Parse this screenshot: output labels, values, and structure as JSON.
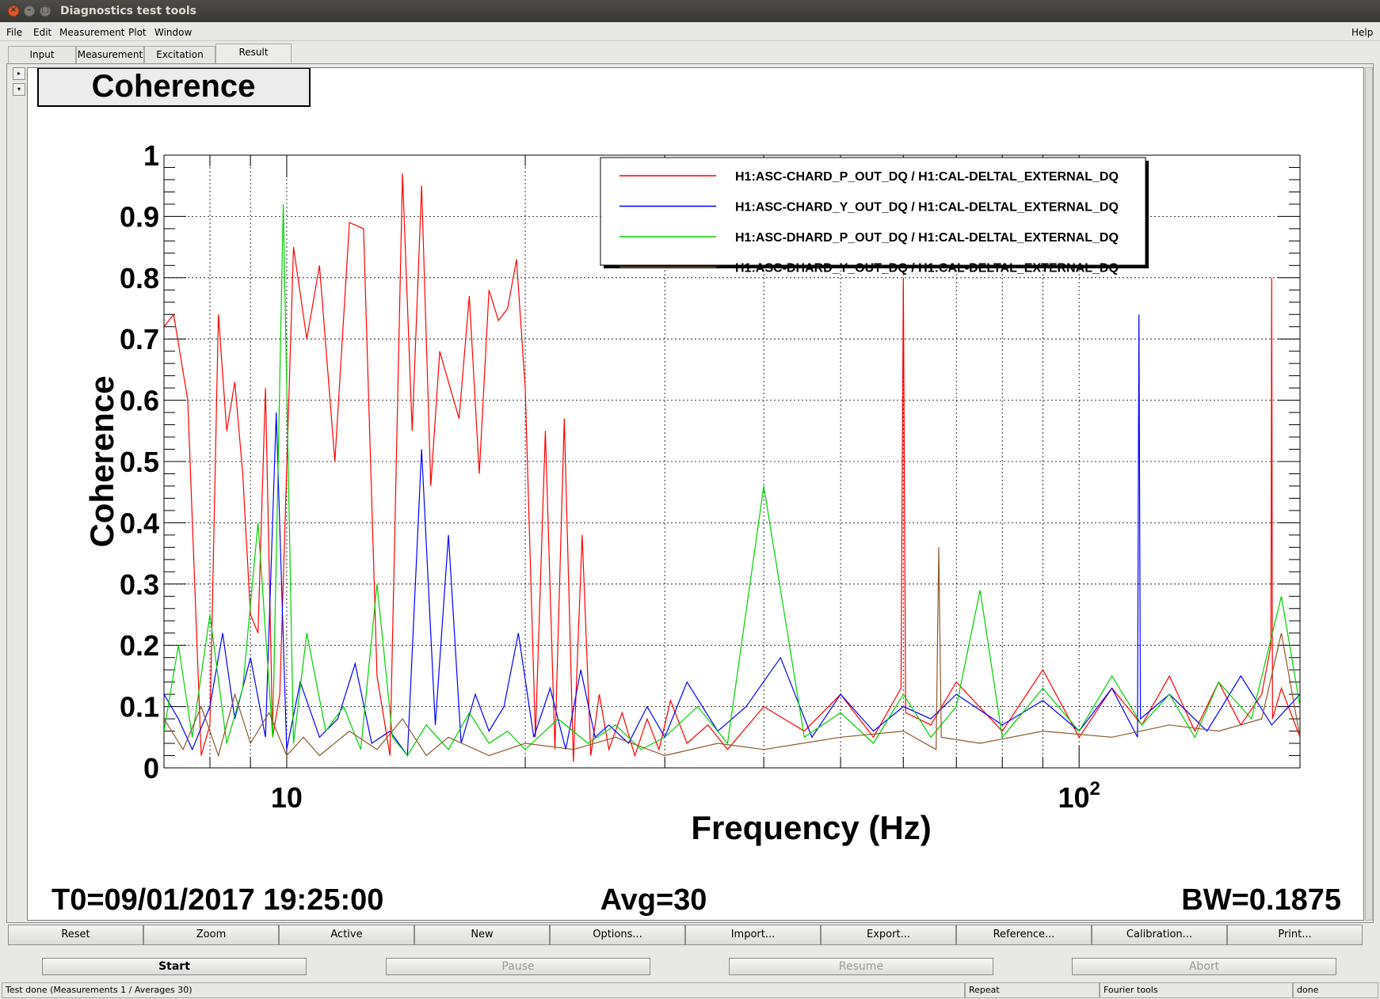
{
  "window": {
    "title": "Diagnostics test tools"
  },
  "menu": {
    "file": "File",
    "edit": "Edit",
    "measurement": "Measurement",
    "plot": "Plot",
    "window": "Window",
    "help": "Help"
  },
  "tabs": [
    "Input",
    "Measurement",
    "Excitation",
    "Result"
  ],
  "active_tab": "Result",
  "plot_title": "Coherence",
  "info": {
    "t0": "T0=09/01/2017 19:25:00",
    "avg": "Avg=30",
    "bw": "BW=0.1875"
  },
  "chart_data": {
    "type": "line",
    "title": "Coherence",
    "xlabel": "Frequency (Hz)",
    "ylabel": "Coherence",
    "x_scale": "log",
    "xlim": [
      7,
      190
    ],
    "ylim": [
      0,
      1
    ],
    "grid": true,
    "legend_position": "top-right",
    "y_ticks": [
      "0",
      "0.1",
      "0.2",
      "0.3",
      "0.4",
      "0.5",
      "0.6",
      "0.7",
      "0.8",
      "0.9",
      "1"
    ],
    "x_tick_labels": [
      {
        "value": 10,
        "base": "10",
        "exp": ""
      },
      {
        "value": 100,
        "base": "10",
        "exp": "2"
      }
    ],
    "series": [
      {
        "name": "H1:ASC-CHARD_P_OUT_DQ / H1:CAL-DELTAL_EXTERNAL_DQ",
        "color": "#ff0000",
        "x": [
          7,
          7.2,
          7.5,
          7.8,
          8.0,
          8.2,
          8.4,
          8.6,
          8.8,
          9.0,
          9.2,
          9.4,
          9.6,
          9.8,
          10.2,
          10.6,
          11.0,
          11.5,
          12.0,
          12.5,
          13.0,
          13.5,
          14.0,
          14.4,
          14.8,
          15.2,
          15.6,
          16.0,
          16.5,
          17.0,
          17.5,
          18.0,
          18.5,
          19.0,
          19.5,
          20.0,
          20.6,
          21.2,
          21.8,
          22.4,
          23.0,
          23.6,
          24.2,
          24.8,
          25.5,
          26.5,
          27.5,
          28.5,
          29.5,
          30.5,
          32.0,
          34.0,
          36.0,
          40.0,
          45.0,
          50.0,
          55.0,
          59.6,
          60.0,
          60.4,
          65.0,
          70.0,
          80.0,
          90.0,
          100.0,
          110.0,
          120.0,
          130.0,
          140.0,
          150.0,
          160.0,
          170.0,
          174.6,
          175.0,
          175.4,
          180.0,
          190.0
        ],
        "y": [
          0.72,
          0.74,
          0.6,
          0.02,
          0.07,
          0.74,
          0.55,
          0.63,
          0.48,
          0.25,
          0.22,
          0.62,
          0.05,
          0.12,
          0.85,
          0.7,
          0.82,
          0.5,
          0.89,
          0.88,
          0.15,
          0.02,
          0.97,
          0.55,
          0.95,
          0.46,
          0.68,
          0.63,
          0.57,
          0.77,
          0.48,
          0.78,
          0.73,
          0.75,
          0.83,
          0.62,
          0.05,
          0.55,
          0.03,
          0.57,
          0.01,
          0.38,
          0.02,
          0.12,
          0.03,
          0.09,
          0.02,
          0.08,
          0.03,
          0.11,
          0.04,
          0.07,
          0.03,
          0.1,
          0.06,
          0.12,
          0.05,
          0.13,
          0.8,
          0.09,
          0.07,
          0.14,
          0.06,
          0.16,
          0.05,
          0.13,
          0.07,
          0.15,
          0.06,
          0.14,
          0.07,
          0.12,
          0.2,
          0.8,
          0.08,
          0.13,
          0.05
        ]
      },
      {
        "name": "H1:ASC-CHARD_Y_OUT_DQ / H1:CAL-DELTAL_EXTERNAL_DQ",
        "color": "#0000ff",
        "x": [
          7,
          7.3,
          7.6,
          8.0,
          8.3,
          8.6,
          9.0,
          9.4,
          9.7,
          10.0,
          10.4,
          11.0,
          11.6,
          12.2,
          12.8,
          13.5,
          14.2,
          14.8,
          15.4,
          16.0,
          16.6,
          17.3,
          18.0,
          18.8,
          19.6,
          20.5,
          21.5,
          22.5,
          23.5,
          24.5,
          25.5,
          27.0,
          28.5,
          30.0,
          32.0,
          35.0,
          38.0,
          42.0,
          46.0,
          50.0,
          55.0,
          60.0,
          65.0,
          70.0,
          80.0,
          90.0,
          100.0,
          110.0,
          118.5,
          119.0,
          119.5,
          130.0,
          145.0,
          160.0,
          175.0,
          190.0
        ],
        "y": [
          0.12,
          0.08,
          0.03,
          0.1,
          0.22,
          0.08,
          0.18,
          0.05,
          0.58,
          0.03,
          0.14,
          0.05,
          0.08,
          0.17,
          0.04,
          0.06,
          0.02,
          0.52,
          0.07,
          0.38,
          0.04,
          0.12,
          0.06,
          0.1,
          0.22,
          0.05,
          0.13,
          0.03,
          0.16,
          0.05,
          0.07,
          0.04,
          0.1,
          0.05,
          0.14,
          0.06,
          0.1,
          0.18,
          0.05,
          0.12,
          0.06,
          0.1,
          0.08,
          0.12,
          0.07,
          0.11,
          0.06,
          0.13,
          0.05,
          0.74,
          0.08,
          0.12,
          0.06,
          0.15,
          0.07,
          0.12
        ]
      },
      {
        "name": "H1:ASC-DHARD_P_OUT_DQ / H1:CAL-DELTAL_EXTERNAL_DQ",
        "color": "#00d000",
        "x": [
          7,
          7.3,
          7.6,
          8.0,
          8.4,
          8.8,
          9.2,
          9.6,
          9.9,
          10.2,
          10.6,
          11.2,
          11.8,
          12.4,
          13.0,
          13.6,
          14.2,
          15.0,
          16.0,
          17.0,
          18.0,
          19.0,
          20.0,
          22.0,
          24.0,
          26.0,
          28.0,
          30.0,
          33.0,
          36.0,
          40.0,
          45.0,
          50.0,
          55.0,
          60.0,
          65.0,
          70.0,
          75.0,
          80.0,
          90.0,
          100.0,
          110.0,
          120.0,
          130.0,
          140.0,
          150.0,
          165.0,
          180.0,
          190.0
        ],
        "y": [
          0.06,
          0.2,
          0.05,
          0.25,
          0.04,
          0.13,
          0.4,
          0.05,
          0.92,
          0.04,
          0.22,
          0.06,
          0.1,
          0.03,
          0.3,
          0.05,
          0.02,
          0.07,
          0.03,
          0.09,
          0.04,
          0.06,
          0.03,
          0.08,
          0.04,
          0.07,
          0.03,
          0.05,
          0.1,
          0.04,
          0.46,
          0.05,
          0.09,
          0.04,
          0.12,
          0.05,
          0.1,
          0.29,
          0.05,
          0.13,
          0.06,
          0.15,
          0.07,
          0.12,
          0.05,
          0.14,
          0.08,
          0.28,
          0.1
        ]
      },
      {
        "name": "H1:ASC-DHARD_Y_OUT_DQ / H1:CAL-DELTAL_EXTERNAL_DQ",
        "color": "#8b5a2b",
        "x": [
          7,
          7.4,
          7.8,
          8.2,
          8.6,
          9.0,
          9.5,
          10.0,
          10.5,
          11.0,
          12.0,
          13.0,
          14.0,
          15.0,
          16.0,
          18.0,
          20.0,
          23.0,
          26.0,
          30.0,
          35.0,
          40.0,
          50.0,
          60.0,
          66.0,
          66.5,
          67.0,
          75.0,
          90.0,
          110.0,
          130.0,
          150.0,
          170.0,
          180.0,
          190.0
        ],
        "y": [
          0.08,
          0.03,
          0.1,
          0.02,
          0.12,
          0.04,
          0.09,
          0.02,
          0.05,
          0.02,
          0.06,
          0.03,
          0.08,
          0.02,
          0.05,
          0.02,
          0.04,
          0.03,
          0.05,
          0.02,
          0.04,
          0.03,
          0.05,
          0.06,
          0.03,
          0.36,
          0.05,
          0.04,
          0.06,
          0.05,
          0.07,
          0.06,
          0.08,
          0.22,
          0.05
        ]
      }
    ]
  },
  "plot_buttons": [
    "Reset",
    "Zoom",
    "Active",
    "New",
    "Options...",
    "Import...",
    "Export...",
    "Reference...",
    "Calibration...",
    "Print..."
  ],
  "controls": {
    "start": "Start",
    "pause": "Pause",
    "resume": "Resume",
    "abort": "Abort"
  },
  "status": {
    "message": "Test done (Measurements 1 / Averages 30)",
    "repeat": "Repeat",
    "fourier": "Fourier tools",
    "state": "done"
  },
  "icons": {
    "close": "close-icon",
    "minimize": "minimize-icon",
    "maximize": "maximize-icon"
  }
}
